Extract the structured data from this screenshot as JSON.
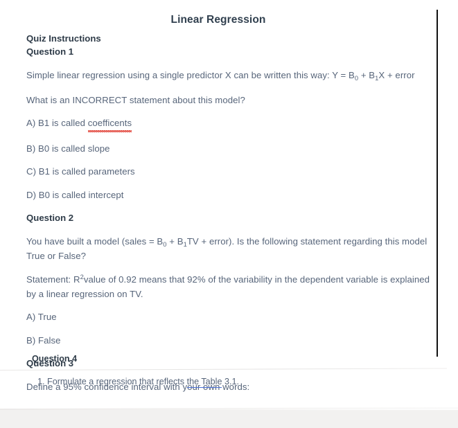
{
  "document": {
    "title": "Linear Regression",
    "instructions_heading": "Quiz Instructions"
  },
  "questions": [
    {
      "heading": "Question 1",
      "prompt_prefix": "Simple linear regression using a single predictor X can be written this way: Y = B",
      "prompt_sub1": "0",
      "prompt_mid": " + B",
      "prompt_sub2": "1",
      "prompt_suffix": "X + error",
      "prompt_full": "Simple linear regression using a single predictor X can be written this way: Y = B0 + B1X + error",
      "subprompt": "What is an INCORRECT statement about this model?",
      "options": [
        {
          "prefix": "A) B1 is called ",
          "misspelled": "coefficents",
          "suffix": ""
        },
        {
          "prefix": "B) B0 is called slope",
          "misspelled": "",
          "suffix": ""
        },
        {
          "prefix": "C) B1 is called parameters",
          "misspelled": "",
          "suffix": ""
        },
        {
          "prefix": "D) B0 is called intercept",
          "misspelled": "",
          "suffix": ""
        }
      ]
    },
    {
      "heading": "Question 2",
      "prompt_prefix": "You have built a model (sales = B",
      "prompt_sub1": "0",
      "prompt_mid": " + B",
      "prompt_sub2": "1",
      "prompt_suffix": "TV + error). Is the following statement regarding this model True or False?",
      "prompt_full": "You have built a model (sales = B0 + B1TV + error). Is the following statement regarding this model True or False?",
      "statement_prefix": "Statement: R",
      "statement_sup": "2",
      "statement_suffix": "value of 0.92 means that 92% of the variability in the dependent variable is explained by a linear regression on TV.",
      "statement_full": "Statement: R2 value of 0.92 means that 92% of the variability in the dependent variable is explained by a linear regression on TV.",
      "options": [
        {
          "prefix": "A) True",
          "misspelled": "",
          "suffix": ""
        },
        {
          "prefix": "B) False",
          "misspelled": "",
          "suffix": ""
        }
      ]
    },
    {
      "heading": "Question 3",
      "prompt_full": "Define a 95% confidence interval with your own words:"
    }
  ],
  "question4": {
    "heading": "Question 4",
    "item_prefix": "1. Formulate a regression that reflects ",
    "item_link": "the Table",
    "item_suffix": " 3.1."
  },
  "colors": {
    "title": "#31404f",
    "heading": "#2e3b48",
    "body": "#57657a",
    "spellcheck_underline": "#e03a2f",
    "grammar_underline": "#4a6fd4",
    "edge_rule": "#111111",
    "bottom_band": "#f2f1f0"
  }
}
